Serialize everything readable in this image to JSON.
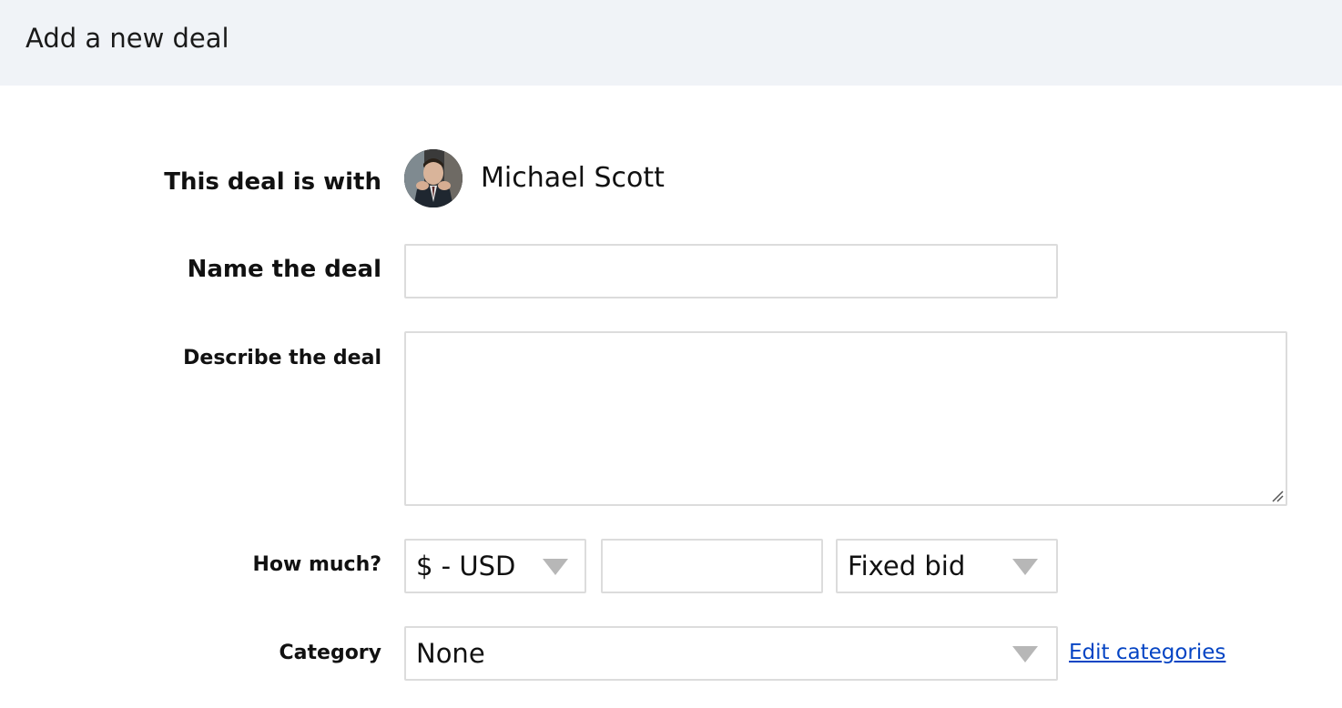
{
  "header": {
    "title": "Add a new deal"
  },
  "form": {
    "deal_with": {
      "label": "This deal is with",
      "contact_name": "Michael Scott",
      "avatar_icon": "contact-photo"
    },
    "name": {
      "label": "Name the deal",
      "value": "",
      "placeholder": ""
    },
    "description": {
      "label": "Describe the deal",
      "value": ""
    },
    "amount": {
      "label": "How much?",
      "currency": "$ - USD",
      "value": "",
      "bid_type": "Fixed bid"
    },
    "category": {
      "label": "Category",
      "value": "None",
      "edit_link": "Edit categories"
    }
  },
  "colors": {
    "header_bg": "#f0f3f7",
    "border": "#dcdcdc",
    "caret": "#b7b7b7",
    "link": "#0645c4"
  }
}
